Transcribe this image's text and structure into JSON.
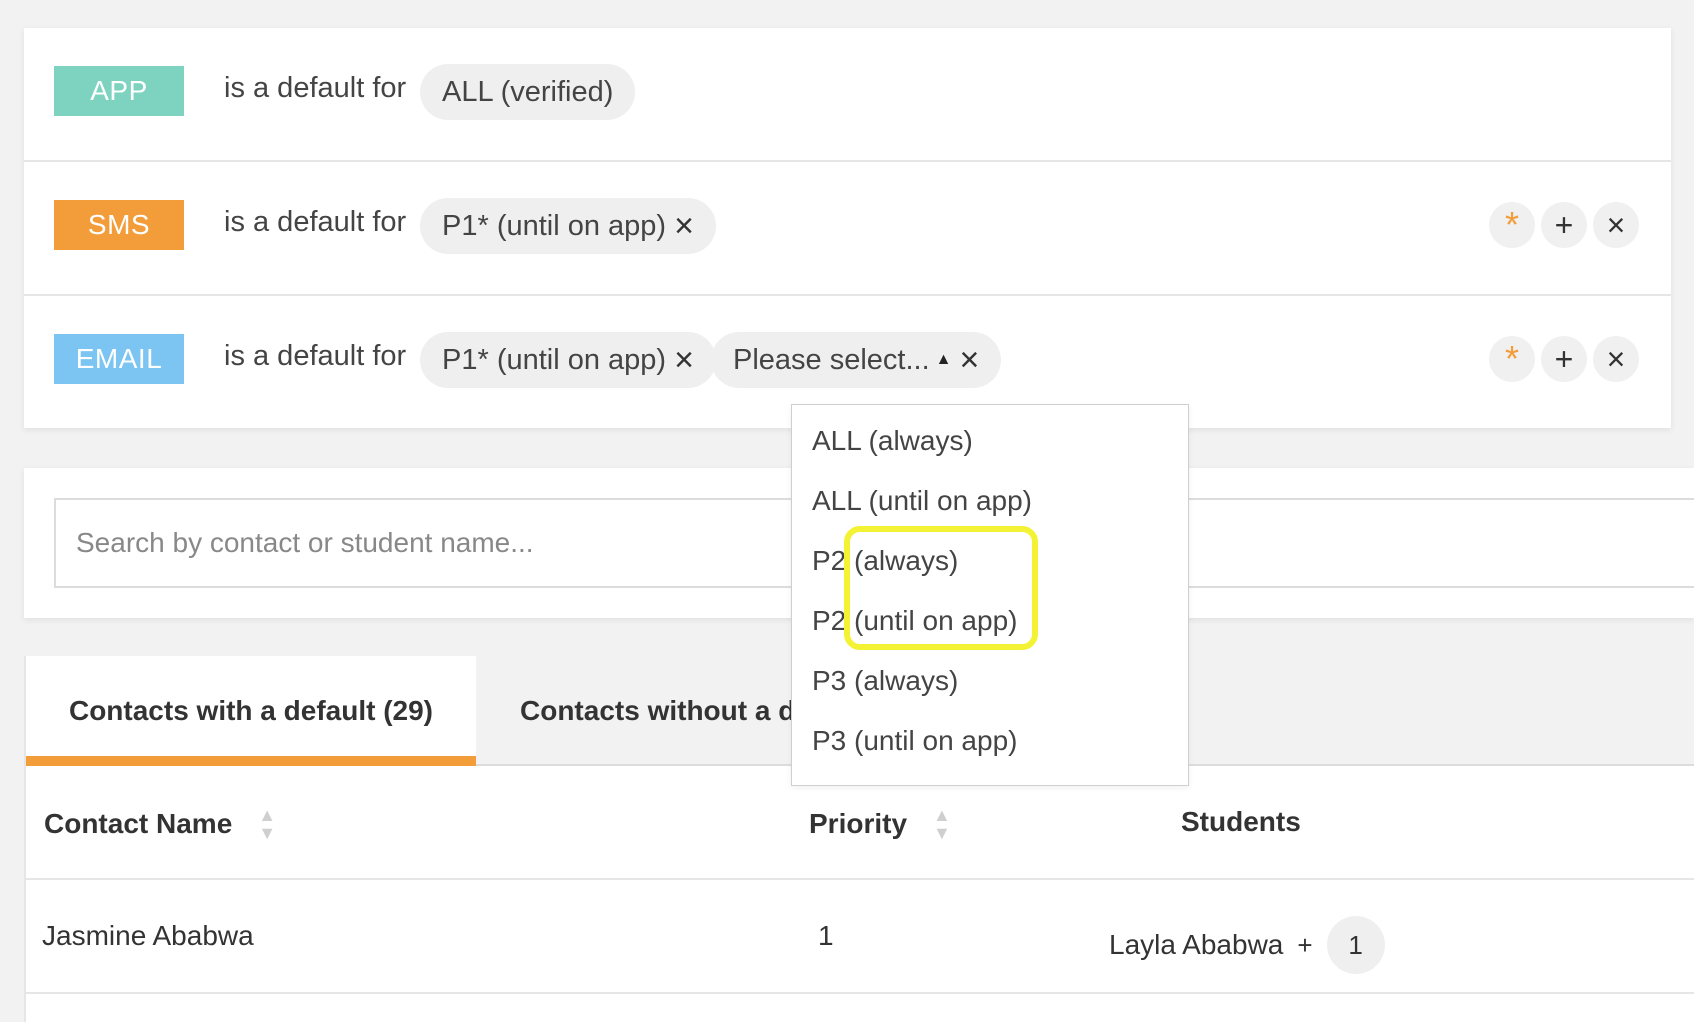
{
  "defaults": {
    "rows": [
      {
        "channel": "APP",
        "channel_color": "#7dd3c0",
        "label": "is a default for",
        "selections": [
          "ALL (verified)"
        ]
      },
      {
        "channel": "SMS",
        "channel_color": "#f39c3a",
        "label": "is a default for",
        "selections": [
          "P1* (until on app)"
        ]
      },
      {
        "channel": "EMAIL",
        "channel_color": "#7cc4f2",
        "label": "is a default for",
        "selections": [
          "P1* (until on app)"
        ],
        "select_placeholder": "Please select..."
      }
    ],
    "actions": {
      "star_icon": "asterisk-icon",
      "add_icon": "plus-icon",
      "remove_icon": "close-icon"
    },
    "accent_color": "#f39c3a"
  },
  "dropdown": {
    "options": [
      "ALL (always)",
      "ALL (until on app)",
      "P2 (always)",
      "P2 (until on app)",
      "P3 (always)",
      "P3 (until on app)"
    ],
    "highlight_color": "#f4f235"
  },
  "search": {
    "placeholder": "Search by contact or student name..."
  },
  "tabs": [
    {
      "label": "Contacts with a default (29)",
      "active": true
    },
    {
      "label": "Contacts without a d",
      "active": false
    }
  ],
  "table": {
    "headers": {
      "contact": "Contact Name",
      "priority": "Priority",
      "students": "Students"
    },
    "rows": [
      {
        "contact": "Jasmine Ababwa",
        "priority": "1",
        "student": "Layla Ababwa",
        "plus": "+",
        "extra_count": "1"
      }
    ]
  }
}
